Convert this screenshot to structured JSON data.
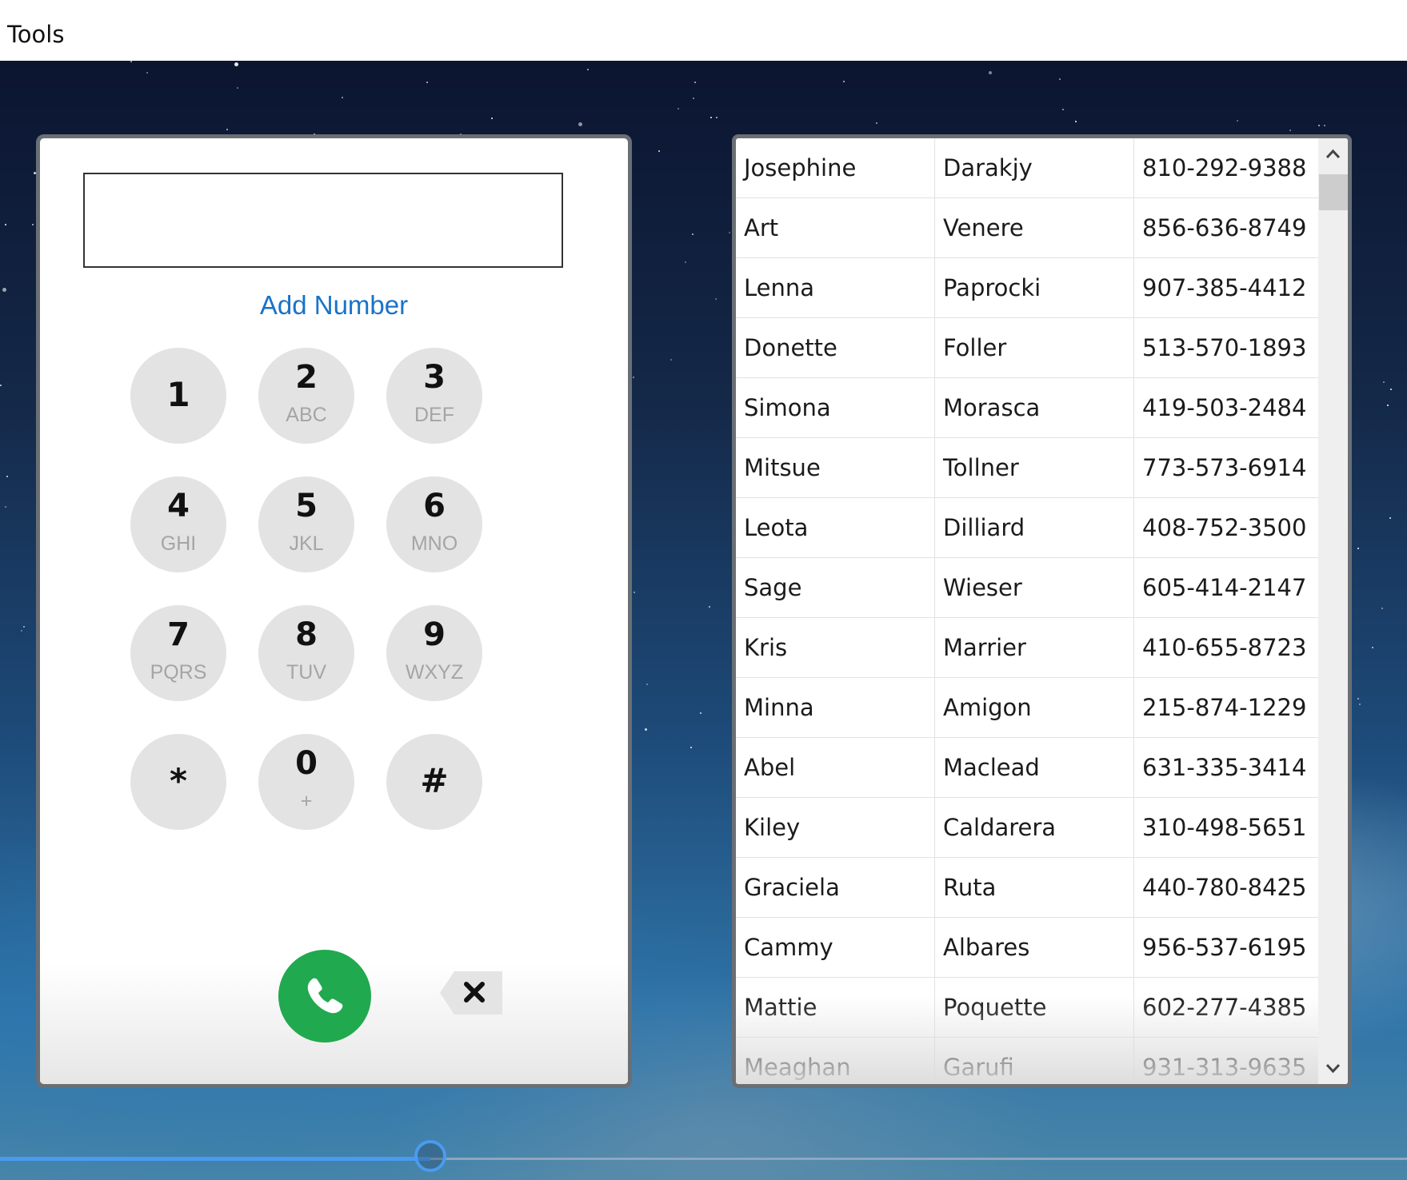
{
  "menu": {
    "tools_label": "Tools"
  },
  "dialer": {
    "number_value": "",
    "add_number_label": "Add Number",
    "keys": [
      {
        "digit": "1",
        "letters": ""
      },
      {
        "digit": "2",
        "letters": "ABC"
      },
      {
        "digit": "3",
        "letters": "DEF"
      },
      {
        "digit": "4",
        "letters": "GHI"
      },
      {
        "digit": "5",
        "letters": "JKL"
      },
      {
        "digit": "6",
        "letters": "MNO"
      },
      {
        "digit": "7",
        "letters": "PQRS"
      },
      {
        "digit": "8",
        "letters": "TUV"
      },
      {
        "digit": "9",
        "letters": "WXYZ"
      },
      {
        "digit": "*",
        "letters": ""
      },
      {
        "digit": "0",
        "letters": "+"
      },
      {
        "digit": "#",
        "letters": ""
      }
    ],
    "call_icon": "phone-icon",
    "backspace_icon": "backspace-icon",
    "call_color": "#20a94e",
    "link_color": "#1a73c8"
  },
  "contacts": {
    "rows": [
      {
        "first": "Josephine",
        "last": "Darakjy",
        "phone": "810-292-9388"
      },
      {
        "first": "Art",
        "last": "Venere",
        "phone": "856-636-8749"
      },
      {
        "first": "Lenna",
        "last": "Paprocki",
        "phone": "907-385-4412"
      },
      {
        "first": "Donette",
        "last": "Foller",
        "phone": "513-570-1893"
      },
      {
        "first": "Simona",
        "last": "Morasca",
        "phone": "419-503-2484"
      },
      {
        "first": "Mitsue",
        "last": "Tollner",
        "phone": "773-573-6914"
      },
      {
        "first": "Leota",
        "last": "Dilliard",
        "phone": "408-752-3500"
      },
      {
        "first": "Sage",
        "last": "Wieser",
        "phone": "605-414-2147"
      },
      {
        "first": "Kris",
        "last": "Marrier",
        "phone": "410-655-8723"
      },
      {
        "first": "Minna",
        "last": "Amigon",
        "phone": "215-874-1229"
      },
      {
        "first": "Abel",
        "last": "Maclead",
        "phone": "631-335-3414"
      },
      {
        "first": "Kiley",
        "last": "Caldarera",
        "phone": "310-498-5651"
      },
      {
        "first": "Graciela",
        "last": "Ruta",
        "phone": "440-780-8425"
      },
      {
        "first": "Cammy",
        "last": "Albares",
        "phone": "956-537-6195"
      },
      {
        "first": "Mattie",
        "last": "Poquette",
        "phone": "602-277-4385"
      },
      {
        "first": "Meaghan",
        "last": "Garufi",
        "phone": "931-313-9635"
      }
    ],
    "scroll_up_icon": "chevron-up-icon",
    "scroll_down_icon": "chevron-down-icon"
  },
  "slider": {
    "value_fraction": 0.306,
    "accent_color": "#4a9bf0"
  }
}
